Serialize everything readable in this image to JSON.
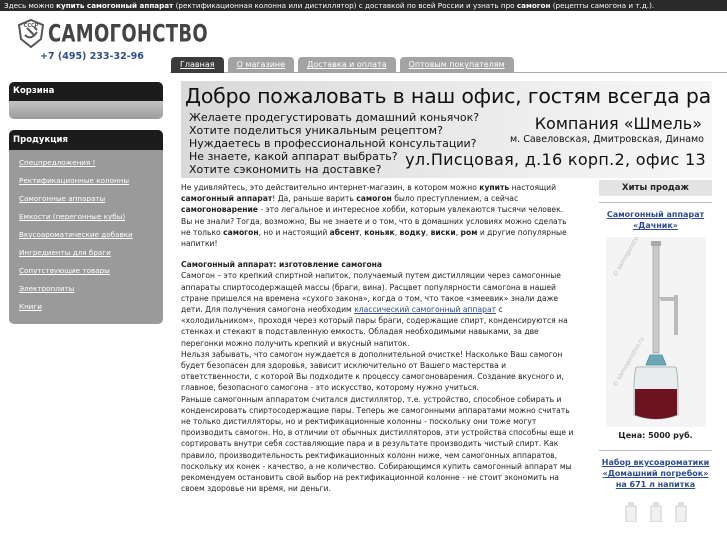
{
  "topbar": {
    "p1": "Здесь можно ",
    "b1": "купить самогонный аппарат",
    "p2": " (ректификационная колонна или дистиллятор) с доставкой по всей России и узнать про ",
    "b2": "самогон",
    "p3": " (рецепты самогона и т.д.)."
  },
  "logo": {
    "emblem_text": "СССР",
    "brand": "САМОГОНСТВО"
  },
  "phone": "+7 (495) 233-32-96",
  "tabs": [
    {
      "label": "Главная",
      "active": true
    },
    {
      "label": "О магазине",
      "active": false
    },
    {
      "label": "Доставка и оплата",
      "active": false
    },
    {
      "label": "Оптовым покупателям",
      "active": false
    }
  ],
  "sidebar": {
    "cart_title": "Корзина",
    "products_title": "Продукция",
    "items": [
      "Спецпредложения !",
      "Ректификационные колонны",
      "Самогонные аппараты",
      "Емкости (перегонные кубы)",
      "Вкусоароматические добавки",
      "Ингредиенты для браги",
      "Сопутствующие товары",
      "Электроплиты",
      "Книги"
    ]
  },
  "banner": {
    "welcome": "Добро пожаловать в наш офис, гостям всегда рады!",
    "questions": [
      "Желаете продегустировать домашний коньячок?",
      "Хотите поделиться уникальным рецептом?",
      "Нуждаетесь в профессиональной консультации?",
      "Не знаете, какой аппарат выбрать?",
      "Хотите сэкономить на доставке?"
    ],
    "company": "Компания «Шмель»",
    "streets": "м. Савеловская, Дмитровская, Динамо",
    "address": "ул.Писцовая, д.16 корп.2, офис 13"
  },
  "content": {
    "intro": {
      "t1": "Не удивляйтесь, это действительно интернет-магазин, в котором можно ",
      "b1": "купить",
      "t2": " настоящий ",
      "b2": "самогонный аппарат",
      "t3": "! Да, раньше варить ",
      "b3": "самогон",
      "t4": " было преступлением, а сейчас ",
      "b4": "самогоноварение",
      "t5": " - это легальное и интересное хобби, которым увлекаются тысячи человек. Вы не знали? Тогда, возможно, Вы не знаете и о том, что в домашних условиях можно сделать не только ",
      "b5": "самогон",
      "t6": ", но и настоящий ",
      "b6": "абсент",
      "t7": ", ",
      "b7": "коньяк",
      "t8": ", ",
      "b8": "водку",
      "t9": ", ",
      "b9": "виски",
      "t10": ", ",
      "b10": "ром",
      "t11": " и другие популярные напитки!"
    },
    "heading": "Самогонный аппарат: изготовление самогона",
    "p2a": "Самогон – это крепкий спиртной напиток, получаемый путем дистилляции через самогонные аппараты спиртосодержащей массы (браги, вина). Расцвет популярности самогона в нашей стране пришелся на времена «сухого закона», когда о том, что такое «змеевик» знали даже дети. Для получения самогона необходим ",
    "p2link": "классический самогонный аппарат",
    "p2b": " с «холодильником», проходя через который пары браги, содержащие спирт, конденсируются на стенках и стекают в подставленную емкость. Обладая необходимыми навыками, за две перегонки можно получить крепкий и вкусный напиток.",
    "p3": "Нельзя забывать, что самогон нуждается в дополнительной очистке! Насколько Ваш самогон будет безопасен для здоровья, зависит исключительно от Вашего мастерства и ответственности, с которой Вы подходите к процессу самогоноварения. Создание вкусного и, главное, безопасного самогона - это искусство, которому нужно учиться.",
    "p4": "Раньше самогонным аппаратом считался дистиллятор, т.е. устройство, способное собирать и конденсировать спиртосодержащие пары. Теперь же самогонными аппаратами можно считать не только дистилляторы, но и ректификационные колонны - поскольку они тоже могут производить самогон. Но, в отличии от обычных дистилляторов, эти устройства способны еще и сортировать внутри себя составляющие пара и в результате производить чистый спирт. Как правило, производительность ректификационных колонн ниже, чем самогонных аппаратов, поскольку их конек - качество, а не количество. Собирающимся купить самогонный аппарат мы рекомендуем остановить свой выбор на ректификационной колонне - не стоит экономить на своем здоровье ни время, ни деньги."
  },
  "hits": {
    "title": "Хиты продаж",
    "product1_line1": "Самогонный аппарат",
    "product1_line2": "«Дачник»",
    "watermark": "© samogonstvo.ru",
    "price1": "Цена: 5000 руб.",
    "product2_line1": "Набор вкусоароматики",
    "product2_line2": "«Домашний погребок»",
    "product2_line3": "на 671 л напитка"
  }
}
